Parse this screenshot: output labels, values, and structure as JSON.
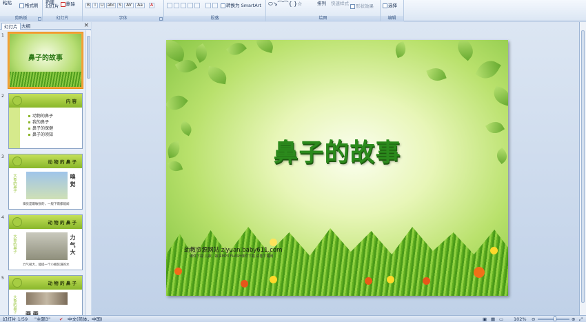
{
  "ribbon": {
    "groups": [
      {
        "key": "clipboard",
        "label": "剪贴板"
      },
      {
        "key": "slides",
        "label": "幻灯片"
      },
      {
        "key": "font",
        "label": "字体"
      },
      {
        "key": "paragraph",
        "label": "段落"
      },
      {
        "key": "drawing",
        "label": "绘图"
      },
      {
        "key": "editing",
        "label": "编辑"
      }
    ],
    "paste_label": "粘贴",
    "format_painter_label": "格式刷",
    "new_slide_label": "新建\n幻灯片",
    "delete_label": "删除",
    "smartart_label": "转换为 SmartArt",
    "arrange_label": "排列",
    "quick_styles_label": "快速样式",
    "shape_effects_label": "形状效果",
    "select_label": "选择",
    "font_buttons": [
      "B",
      "I",
      "U",
      "abc",
      "S",
      "AV",
      "Aa",
      "A"
    ]
  },
  "panel": {
    "tab_slides": "幻灯片",
    "tab_outline": "大纲",
    "close": "×",
    "thumbs": [
      {
        "num": "1",
        "title": "鼻子的故事"
      },
      {
        "num": "2",
        "header": "内 容",
        "items": [
          "动物的鼻子",
          "我的鼻子",
          "鼻子的保健",
          "鼻子的须知"
        ]
      },
      {
        "num": "3",
        "header": "动 物 的 鼻 子",
        "side": "大象的鼻子",
        "vert": "嗅 觉",
        "caption": "嗅觉是最敏锐的，一般下雨都能闻"
      },
      {
        "num": "4",
        "header": "动 物 的 鼻 子",
        "side": "大象的鼻子",
        "vert": "力 气 大",
        "caption": "力气很大，能提一个小桶装满的水"
      },
      {
        "num": "5",
        "header": "动 物 的 鼻 子",
        "side": "大象的鼻子",
        "vert": "画 画"
      }
    ]
  },
  "slide": {
    "title": "鼻子的故事",
    "site": "幼教资源网站  ziyuan.baby611.com",
    "site_sub": "课件下载   儿歌、故事MP3   FLASH课件下载   试卷下载网"
  },
  "status": {
    "slide_count": "幻灯片 1/59",
    "theme": "\"主题3\"",
    "language": "中文(简体，中国)",
    "zoom": "102%",
    "zoom_value": 0.55
  }
}
